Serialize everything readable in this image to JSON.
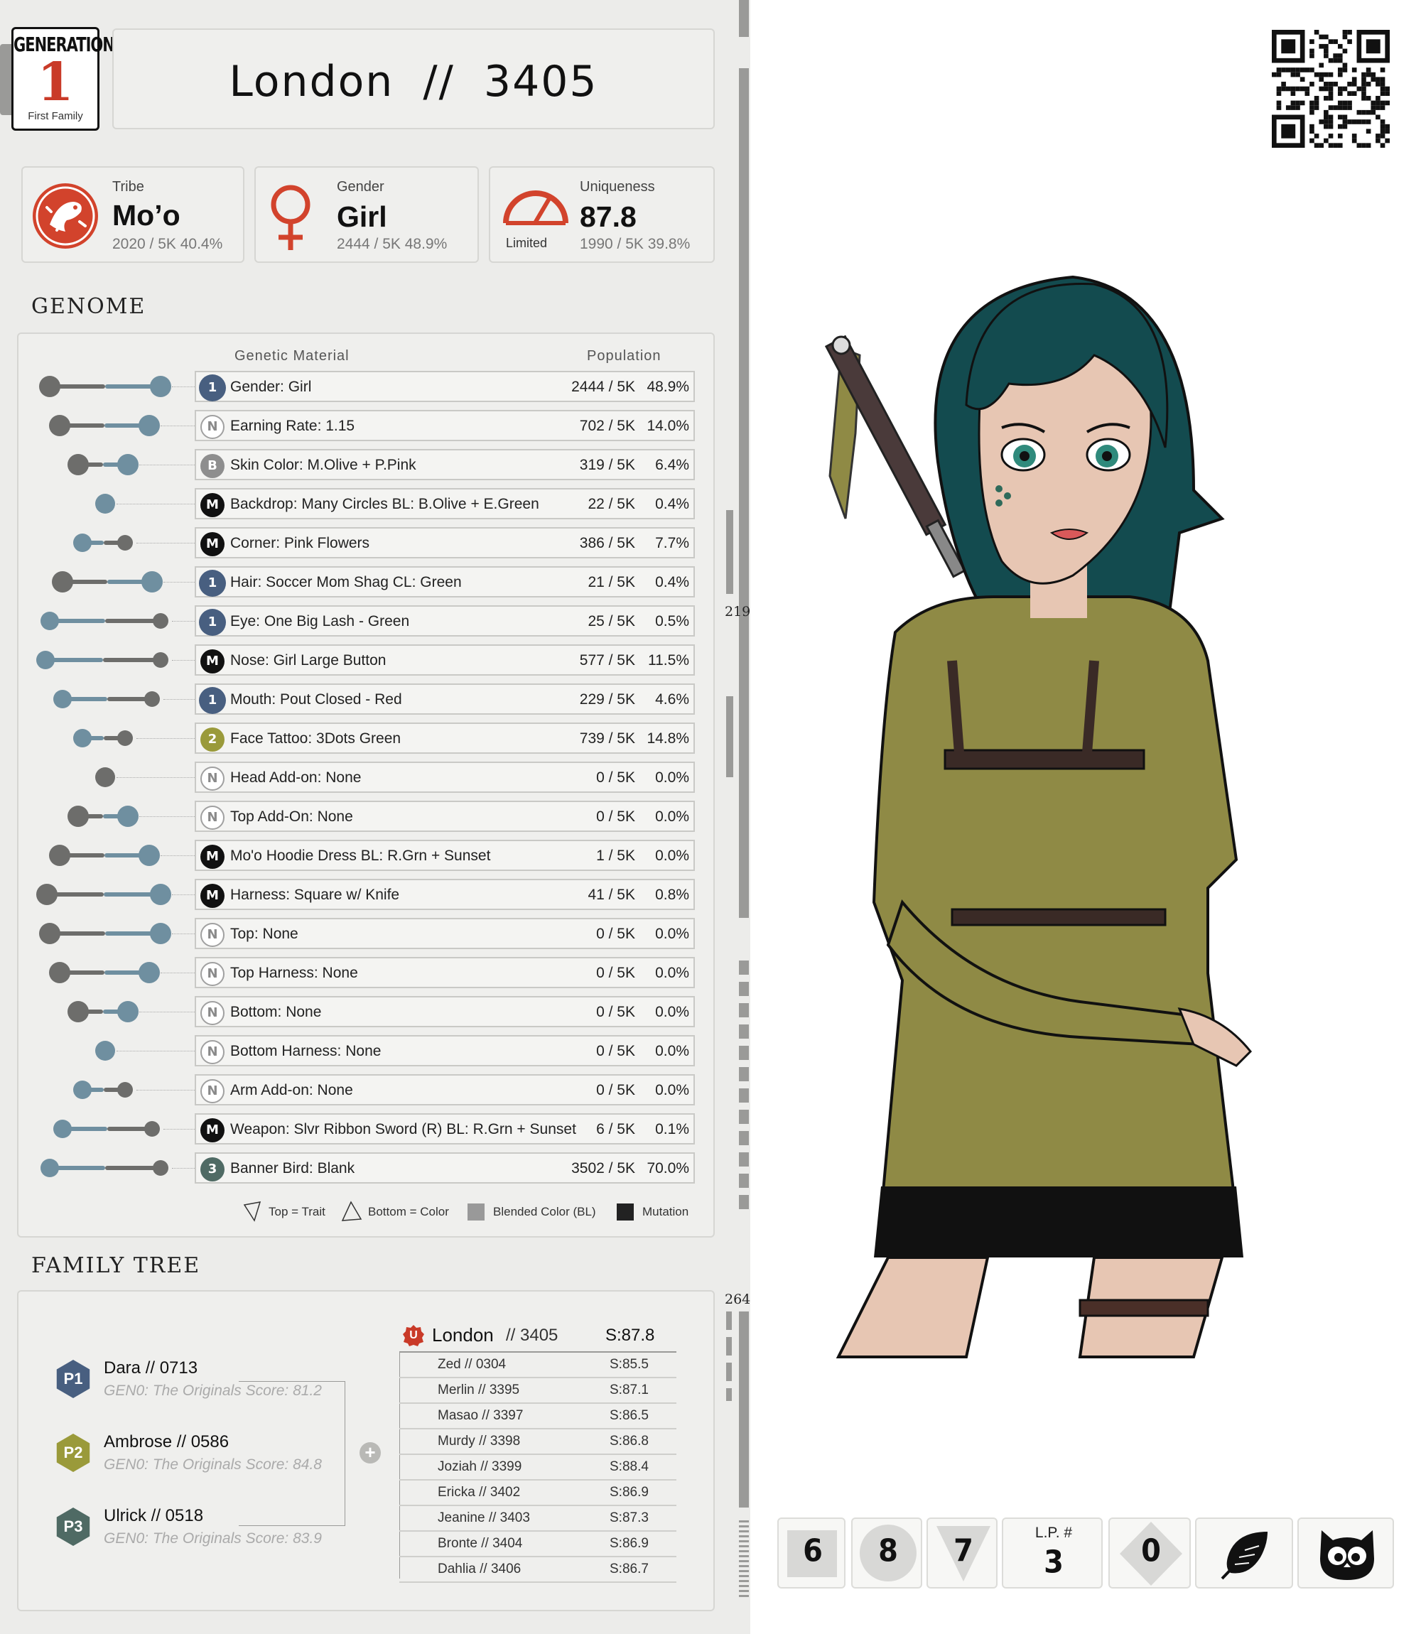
{
  "generation": {
    "label": "GENERATION",
    "number": "1",
    "subtitle": "First Family"
  },
  "title": {
    "name": "London",
    "separator": "//",
    "id": "3405"
  },
  "stats": {
    "tribe": {
      "label": "Tribe",
      "value": "Mo’o",
      "sub": "2020 / 5K  40.4%"
    },
    "gender": {
      "label": "Gender",
      "value": "Girl",
      "sub": "2444 / 5K  48.9%"
    },
    "uniqueness": {
      "label": "Uniqueness",
      "value": "87.8",
      "rating": "Limited",
      "sub": "1990 / 5K  39.8%"
    }
  },
  "genome": {
    "heading": "GENOME",
    "col_material": "Genetic Material",
    "col_population": "Population",
    "rows": [
      {
        "badge": "1",
        "name": "Gender: Girl",
        "count": "2444 / 5K",
        "pct": "48.9%"
      },
      {
        "badge": "N",
        "name": "Earning Rate: 1.15",
        "count": "702 / 5K",
        "pct": "14.0%"
      },
      {
        "badge": "B",
        "name": "Skin Color: M.Olive + P.Pink",
        "count": "319 / 5K",
        "pct": "6.4%"
      },
      {
        "badge": "M",
        "name": "Backdrop: Many Circles BL: B.Olive + E.Green",
        "count": "22 / 5K",
        "pct": "0.4%"
      },
      {
        "badge": "M",
        "name": "Corner: Pink Flowers",
        "count": "386 / 5K",
        "pct": "7.7%"
      },
      {
        "badge": "1",
        "name": "Hair: Soccer Mom Shag CL: Green",
        "count": "21 / 5K",
        "pct": "0.4%"
      },
      {
        "badge": "1",
        "name": "Eye: One Big Lash - Green",
        "count": "25 / 5K",
        "pct": "0.5%"
      },
      {
        "badge": "M",
        "name": "Nose: Girl Large Button",
        "count": "577 / 5K",
        "pct": "11.5%"
      },
      {
        "badge": "1",
        "name": "Mouth: Pout Closed - Red",
        "count": "229 / 5K",
        "pct": "4.6%"
      },
      {
        "badge": "2",
        "name": "Face Tattoo: 3Dots Green",
        "count": "739 / 5K",
        "pct": "14.8%"
      },
      {
        "badge": "N",
        "name": "Head Add-on:  None",
        "count": "0 / 5K",
        "pct": "0.0%"
      },
      {
        "badge": "N",
        "name": "Top Add-On:  None",
        "count": "0 / 5K",
        "pct": "0.0%"
      },
      {
        "badge": "M",
        "name": "Mo'o Hoodie Dress BL: R.Grn + Sunset",
        "count": "1 / 5K",
        "pct": "0.0%"
      },
      {
        "badge": "M",
        "name": "Harness: Square w/ Knife",
        "count": "41 / 5K",
        "pct": "0.8%"
      },
      {
        "badge": "N",
        "name": "Top: None",
        "count": "0 / 5K",
        "pct": "0.0%"
      },
      {
        "badge": "N",
        "name": "Top Harness: None",
        "count": "0 / 5K",
        "pct": "0.0%"
      },
      {
        "badge": "N",
        "name": "Bottom: None",
        "count": "0 / 5K",
        "pct": "0.0%"
      },
      {
        "badge": "N",
        "name": "Bottom Harness: None",
        "count": "0 / 5K",
        "pct": "0.0%"
      },
      {
        "badge": "N",
        "name": "Arm Add-on: None",
        "count": "0 / 5K",
        "pct": "0.0%"
      },
      {
        "badge": "M",
        "name": "Weapon: Slvr Ribbon Sword (R) BL: R.Grn + Sunset",
        "count": "6 / 5K",
        "pct": "0.1%"
      },
      {
        "badge": "3",
        "name": "Banner Bird:  Blank",
        "count": "3502 / 5K",
        "pct": "70.0%"
      }
    ],
    "legend": {
      "trait": "Top = Trait",
      "color": "Bottom = Color",
      "blended": "Blended Color (BL)",
      "mutation": "Mutation"
    }
  },
  "family": {
    "heading": "FAMILY TREE",
    "parents": [
      {
        "badge": "P1",
        "name": "Dara  //  0713",
        "sub": "GEN0: The Originals Score: 81.2",
        "color": "#485f80"
      },
      {
        "badge": "P2",
        "name": "Ambrose  //  0586",
        "sub": "GEN0: The Originals Score: 84.8",
        "color": "#9a9a3a"
      },
      {
        "badge": "P3",
        "name": "Ulrick  //  0518",
        "sub": "GEN0: The Originals Score: 83.9",
        "color": "#4f6a64"
      }
    ],
    "self": {
      "badge": "U",
      "name": "London",
      "id": "// 3405",
      "score": "S:87.8"
    },
    "siblings": [
      {
        "name": "Zed  //  0304",
        "score": "S:85.5"
      },
      {
        "name": "Merlin  //  3395",
        "score": "S:87.1"
      },
      {
        "name": "Masao  //  3397",
        "score": "S:86.5"
      },
      {
        "name": "Murdy  //  3398",
        "score": "S:86.8"
      },
      {
        "name": "Joziah  //  3399",
        "score": "S:88.4"
      },
      {
        "name": "Ericka  //  3402",
        "score": "S:86.9"
      },
      {
        "name": "Jeanine  //  3403",
        "score": "S:87.3"
      },
      {
        "name": "Bronte  //  3404",
        "score": "S:86.9"
      },
      {
        "name": "Dahlia  //  3406",
        "score": "S:86.7"
      }
    ]
  },
  "scroll_markers": {
    "m1": "219",
    "m2": "264"
  },
  "bottom_traits": {
    "square": "6",
    "circle": "8",
    "triangle": "7",
    "lp_label": "L.P. #",
    "lp_value": "3",
    "diamond": "0",
    "leaf_icon": "leaf-icon",
    "owl_icon": "owl-icon"
  },
  "colors": {
    "accent": "#c93a28",
    "blue": "#485f80",
    "olive": "#9a9a3a",
    "teal": "#4f6a64"
  }
}
